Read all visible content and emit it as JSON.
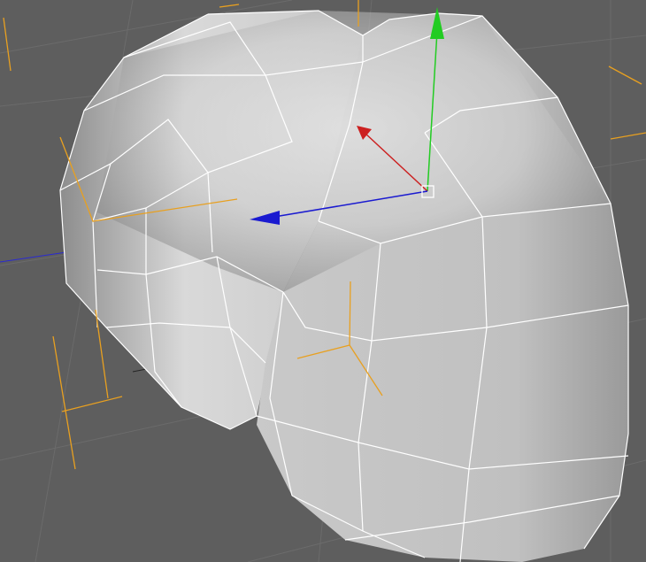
{
  "viewport": {
    "type": "3d-perspective-viewport",
    "background_color": "#5e5e5e",
    "grid_color": "#6b6b6b",
    "grid_major_color": "#252525"
  },
  "mesh": {
    "surface_color": "#bdbdbd",
    "wireframe_color": "#ffffff",
    "bounding_box_color": "#e8a020"
  },
  "gizmo": {
    "x_axis_color": "#cc2020",
    "y_axis_color": "#22cc22",
    "z_axis_color": "#1a1ad0",
    "pivot_color": "#ffffff"
  }
}
